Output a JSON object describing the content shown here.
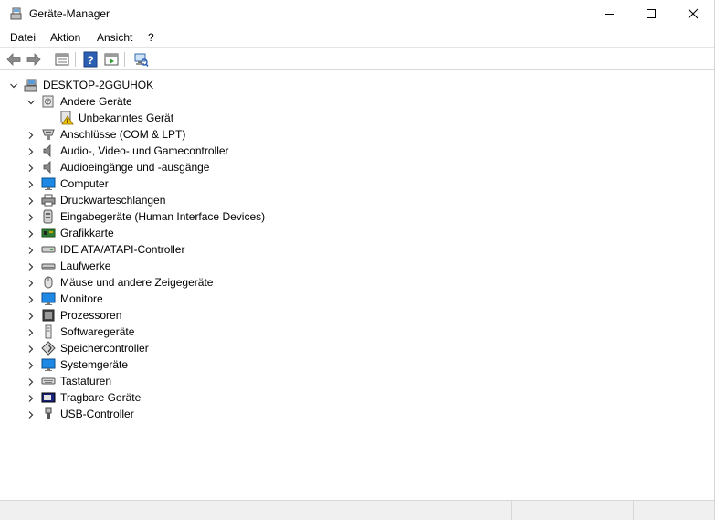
{
  "window": {
    "title": "Geräte-Manager"
  },
  "menu": {
    "datei": "Datei",
    "aktion": "Aktion",
    "ansicht": "Ansicht",
    "help": "?"
  },
  "toolbar": {
    "buttons": [
      "back-icon",
      "forward-icon",
      "properties-icon",
      "help-icon",
      "run-icon",
      "scan-hardware-icon"
    ]
  },
  "tree": {
    "root": "DESKTOP-2GGUHOK",
    "other_devices": "Andere Geräte",
    "unknown_device": "Unbekanntes Gerät",
    "categories": [
      {
        "label": "Anschlüsse (COM & LPT)",
        "icon": "port-icon"
      },
      {
        "label": "Audio-, Video- und Gamecontroller",
        "icon": "speaker-icon"
      },
      {
        "label": "Audioeingänge und -ausgänge",
        "icon": "speaker-icon"
      },
      {
        "label": "Computer",
        "icon": "monitor-icon"
      },
      {
        "label": "Druckwarteschlangen",
        "icon": "printer-icon"
      },
      {
        "label": "Eingabegeräte (Human Interface Devices)",
        "icon": "hid-icon"
      },
      {
        "label": "Grafikkarte",
        "icon": "display-adapter-icon"
      },
      {
        "label": "IDE ATA/ATAPI-Controller",
        "icon": "ide-controller-icon"
      },
      {
        "label": "Laufwerke",
        "icon": "disk-drive-icon"
      },
      {
        "label": "Mäuse und andere Zeigegeräte",
        "icon": "mouse-icon"
      },
      {
        "label": "Monitore",
        "icon": "monitor-icon"
      },
      {
        "label": "Prozessoren",
        "icon": "processor-icon"
      },
      {
        "label": "Softwaregeräte",
        "icon": "software-device-icon"
      },
      {
        "label": "Speichercontroller",
        "icon": "storage-controller-icon"
      },
      {
        "label": "Systemgeräte",
        "icon": "monitor-icon"
      },
      {
        "label": "Tastaturen",
        "icon": "keyboard-icon"
      },
      {
        "label": "Tragbare Geräte",
        "icon": "portable-device-icon"
      },
      {
        "label": "USB-Controller",
        "icon": "usb-icon"
      }
    ]
  },
  "colors": {
    "accent": "#0078d7",
    "warning": "#f2c200"
  }
}
